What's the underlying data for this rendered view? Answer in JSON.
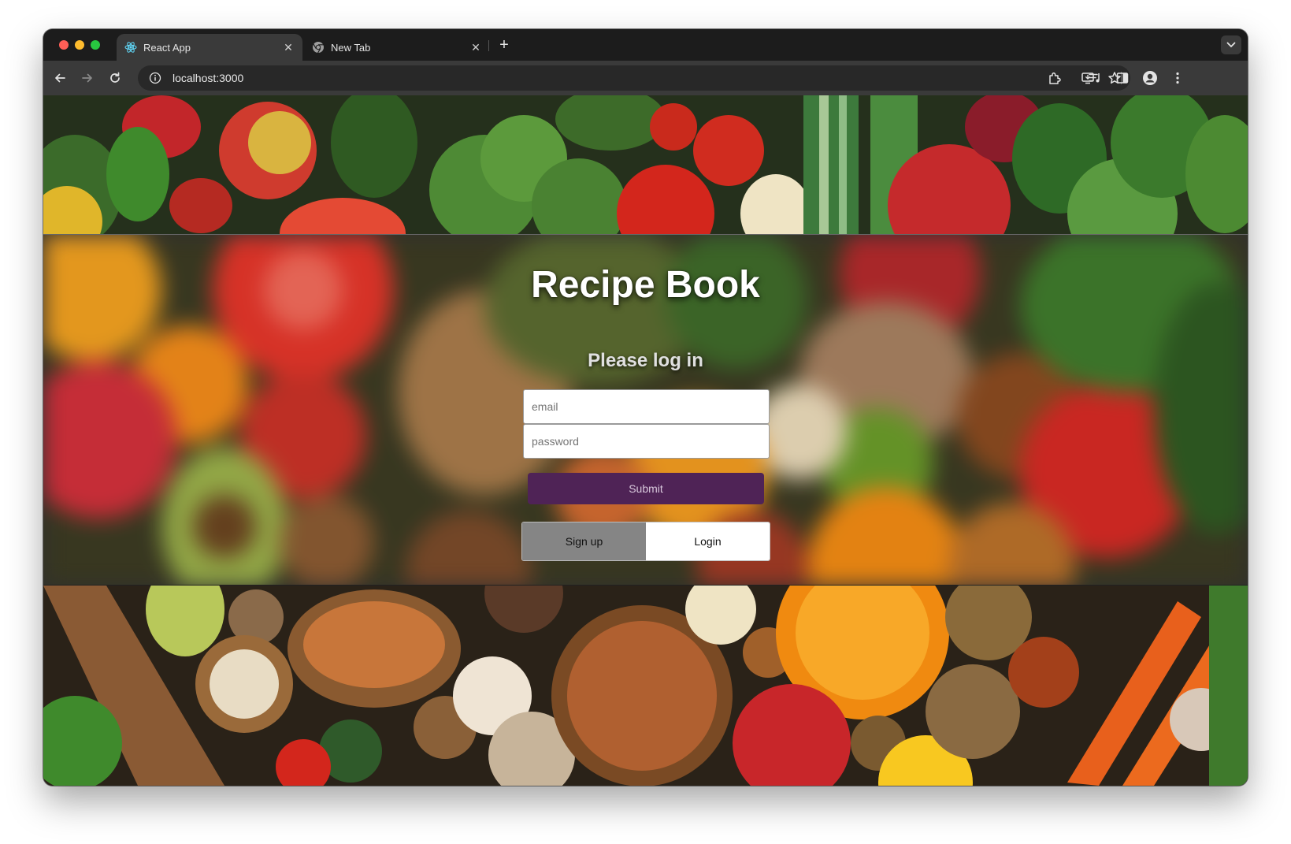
{
  "browser": {
    "tabs": [
      {
        "title": "React App",
        "active": true,
        "favicon": "react-icon"
      },
      {
        "title": "New Tab",
        "active": false,
        "favicon": "chrome-icon"
      }
    ],
    "close_glyph": "✕",
    "new_tab_glyph": "+",
    "url": "localhost:3000"
  },
  "page": {
    "title": "Recipe Book",
    "login_heading": "Please log in",
    "email_placeholder": "email",
    "password_placeholder": "password",
    "submit_label": "Submit",
    "signup_label": "Sign up",
    "login_label": "Login",
    "selected_mode": "Login"
  },
  "colors": {
    "submit_bg": "#4f2356",
    "signup_bg": "#858585",
    "login_bg": "#ffffff"
  }
}
